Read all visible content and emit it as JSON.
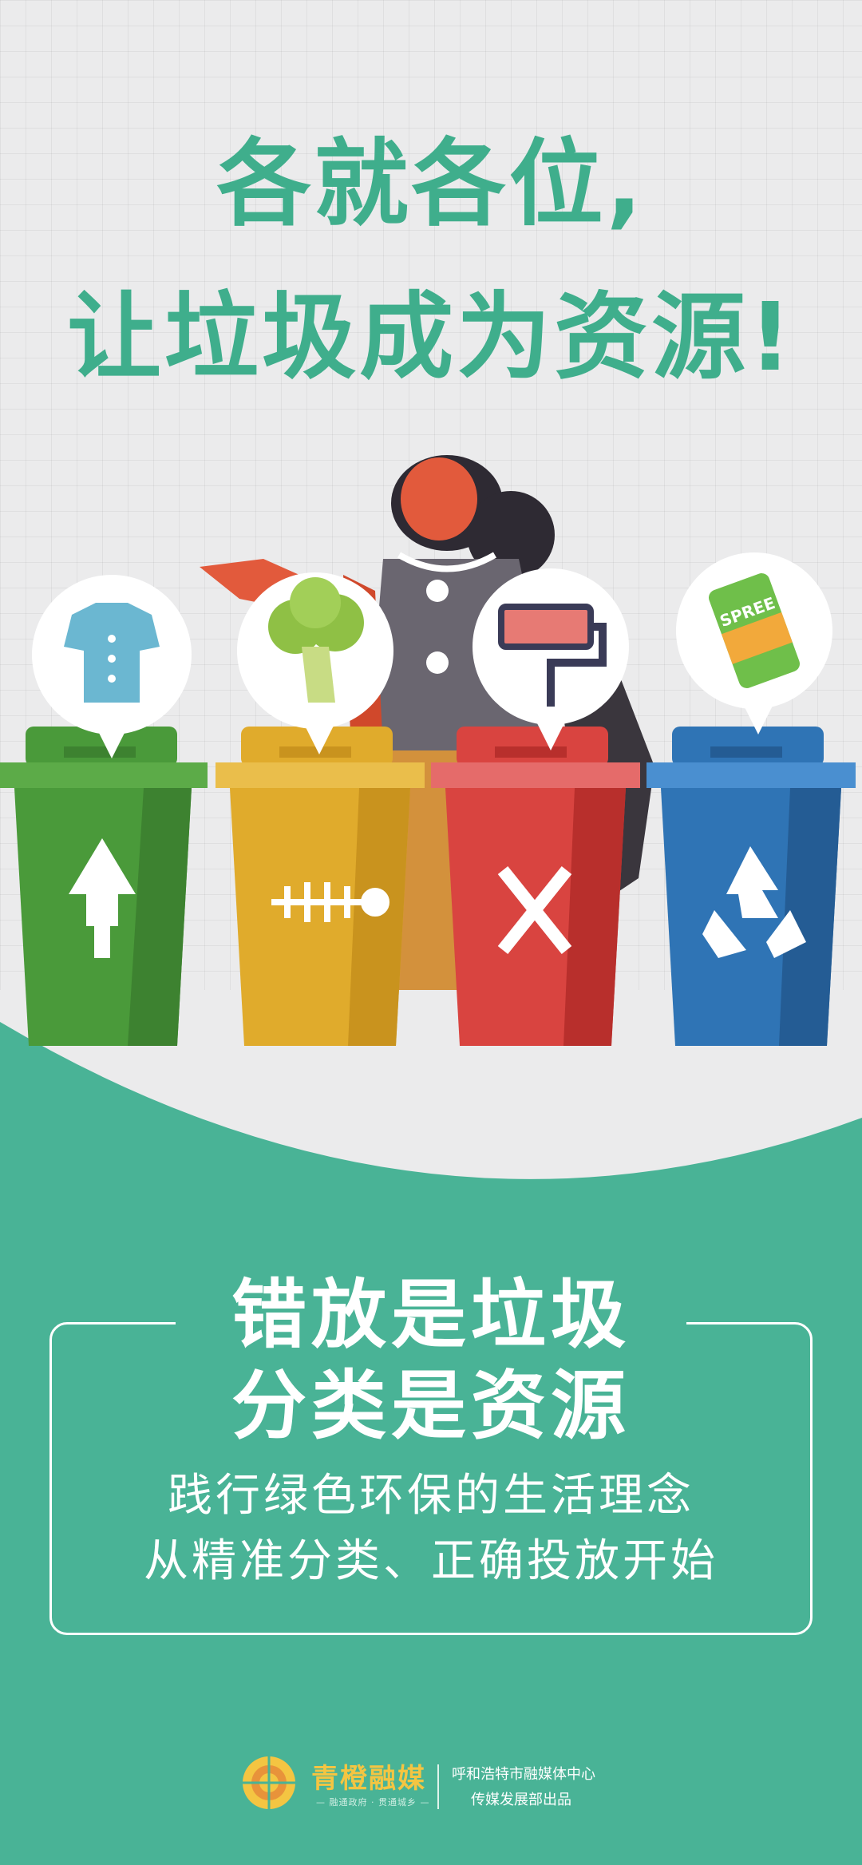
{
  "headline": {
    "line1": "各就各位,",
    "line2": "让垃圾成为资源!"
  },
  "slogan": {
    "line1": "错放是垃圾",
    "line2": "分类是资源"
  },
  "subtitle": {
    "line1": "践行绿色环保的生活理念",
    "line2": "从精准分类、正确投放开始"
  },
  "bins": [
    {
      "name": "green-bin",
      "color": "#4a9a3a",
      "item": "shirt-icon",
      "symbol": "recycle-tree-icon"
    },
    {
      "name": "yellow-bin",
      "color": "#e0ab2c",
      "item": "broccoli-icon",
      "symbol": "fish-bone-icon"
    },
    {
      "name": "red-bin",
      "color": "#d94440",
      "item": "paint-roller-icon",
      "symbol": "hazard-x-icon"
    },
    {
      "name": "blue-bin",
      "color": "#2f74b5",
      "item": "soda-can-icon",
      "symbol": "recycle-arrows-icon"
    }
  ],
  "can_label": "SPREE",
  "footer": {
    "brand": "青橙融媒",
    "brand_tagline": "— 融通政府 · 贯通城乡 —",
    "org_line1": "呼和浩特市融媒体中心",
    "org_line2": "传媒发展部出品"
  },
  "colors": {
    "accent_green": "#3fae8c",
    "panel_green": "#49b396",
    "background": "#ebebec"
  }
}
